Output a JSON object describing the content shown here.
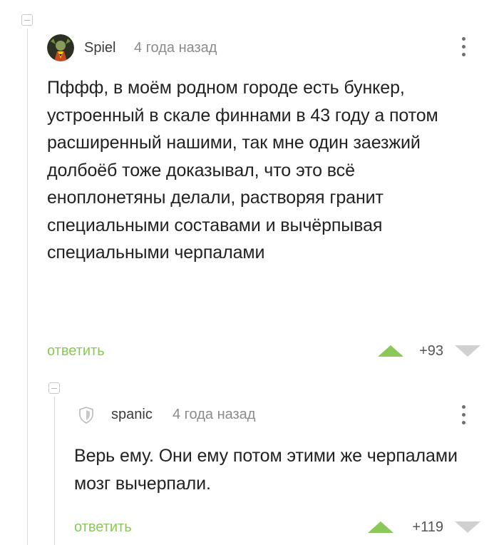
{
  "comments": [
    {
      "author": "Spiel",
      "time": "4 года назад",
      "text": "Пффф, в моём родном городе есть бункер, устроенный в скале финнами в 43 году а потом расширенный нашими, так мне один заезжий долбоёб тоже доказывал, что это всё еноплонетяны делали, растворяя гранит специальными составами и вычёрпывая специальными черпалами",
      "reply_label": "ответить",
      "rating": "+93"
    },
    {
      "author": "spanic",
      "time": "4 года назад",
      "text": "Верь ему. Они ему потом этими же черпалами мозг вычерпали.",
      "reply_label": "ответить",
      "rating": "+119"
    }
  ],
  "icons": {
    "menu": "more-vertical-icon",
    "collapse": "collapse-minus-icon",
    "vote_up": "triangle-up-icon",
    "vote_down": "triangle-down-icon",
    "avatar_placeholder": "shield-icon"
  },
  "colors": {
    "accent_green": "#8ac858",
    "vote_down_gray": "#d0d0d0",
    "thread_line": "#dcdcdc"
  }
}
